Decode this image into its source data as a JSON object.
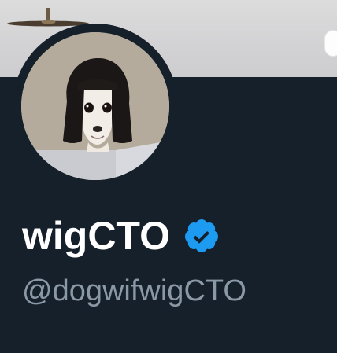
{
  "profile": {
    "display_name": "wigCTO",
    "handle": "@dogwifwigCTO",
    "verified": true
  },
  "icons": {
    "verified_badge": "verified-badge-icon",
    "avatar": "dog-with-wig-avatar"
  },
  "colors": {
    "background": "#15202b",
    "display_name": "#ffffff",
    "handle": "#8b98a5",
    "verified_badge": "#1d9bf0"
  }
}
